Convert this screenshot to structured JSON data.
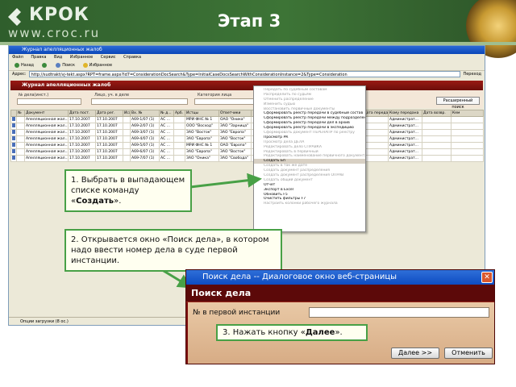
{
  "slide": {
    "logo_name": "КРОК",
    "logo_url": "www.croc.ru",
    "title": "Этап 3"
  },
  "window": {
    "title": "Журнал апелляционных жалоб"
  },
  "menu": [
    "Файл",
    "Правка",
    "Вид",
    "Избранное",
    "Сервис",
    "Справка"
  ],
  "toolbar": {
    "back": "Назад",
    "search": "Поиск",
    "favorites": "Избранное",
    "go": "Переход"
  },
  "address": {
    "label": "Адрес:",
    "value": "http://sudtrakt/vj-tekt.aspx?RPT=frame.aspx?Id7=ConsiderationDocSearch&Type=InitialCaseDocsSearchWithConsiderationInstance=2&Type=Consideration"
  },
  "journal_title": "Журнал апелляционных жалоб",
  "filters": {
    "case_no": "№ дела(инст.)",
    "person": "Лицо, уч. в деле",
    "category": "Категория лица",
    "extended_search": "Расширенный поиск"
  },
  "grid": {
    "headers": [
      "",
      "№",
      "Документ",
      "Дата пост.",
      "Дата рег.",
      "Исх.",
      "Вх. №",
      "№ д...",
      "Арб.",
      "Истцы",
      "Ответчики",
      "",
      "",
      "",
      "Дата передачи",
      "Кому передана",
      "Дата возвр.",
      "Кем"
    ],
    "rows": [
      [
        "Апелляционная жал...",
        "17.10.2007",
        "17.10.2007",
        "А69-1/07 (1)",
        "АС ...",
        "МРИ ФНС № 1",
        "ОАО \"Оника\"",
        "Администрат..."
      ],
      [
        "Апелляционная жал...",
        "17.10.2007",
        "17.10.2007",
        "А69-2/07 (1)",
        "АС ...",
        "ООО \"Восход\"",
        "ЗАО \"Зарница\"",
        "Администрат..."
      ],
      [
        "Апелляционная жал...",
        "17.10.2007",
        "17.10.2007",
        "А69-3/07 (1)",
        "АС ...",
        "ЗАО \"Восток\"",
        "ЗАО \"Европа\"",
        "Администрат..."
      ],
      [
        "Апелляционная жал...",
        "17.10.2007",
        "17.10.2007",
        "А69-4/07 (1)",
        "АС ...",
        "ЗАО \"Европа\"",
        "ЗАО \"Восток\"",
        "Администрат..."
      ],
      [
        "Апелляционная жал...",
        "17.10.2007",
        "17.10.2007",
        "А69-5/07 (1)",
        "АС ...",
        "МРИ ФНС № 1",
        "ОАО \"Европа\"",
        "Администрат..."
      ],
      [
        "Апелляционная жал...",
        "17.10.2007",
        "17.10.2007",
        "А69-6/07 (1)",
        "АС ...",
        "ЗАО \"Европа\"",
        "ЗАО \"Восток\"",
        "Администрат..."
      ],
      [
        "Апелляционная жал...",
        "17.10.2007",
        "17.10.2007",
        "А69-7/07 (1)",
        "АС ...",
        "ЗАО \"Оника\"",
        "ЗАО \"Свобода\"",
        "Администрат..."
      ]
    ]
  },
  "context_menu": [
    {
      "label": "Передать по судебным составам",
      "state": "disabled"
    },
    {
      "label": "Распределить по судьям",
      "state": "disabled"
    },
    {
      "label": "Отменить распределение",
      "state": "disabled"
    },
    {
      "label": "Изменить судью",
      "state": "disabled"
    },
    {
      "label": "Восстановить первичные документы",
      "state": "disabled"
    },
    {
      "label": "Сформировать реестр передачи в судебный состав",
      "state": "normal"
    },
    {
      "label": "Сформировать реестр передачи между подразделениями",
      "state": "normal"
    },
    {
      "label": "Сформировать реестр передачи дел в архив",
      "state": "normal"
    },
    {
      "label": "Сформировать реестр передачи в экспедицию",
      "state": "normal"
    },
    {
      "label": "Сформировать документ ПЕРЕНАПР по реестру",
      "state": "disabled"
    },
    {
      "label": "Просмотр РК",
      "state": "normal"
    },
    {
      "label": "Просмотр дела ДЕЛА",
      "state": "disabled"
    },
    {
      "label": "Редактировать дело СПРАВКА",
      "state": "disabled"
    },
    {
      "label": "Редактировать в первичный",
      "state": "disabled"
    },
    {
      "label": "Редактировать наименование первичного документа",
      "state": "disabled"
    },
    {
      "label": "Создать Бп",
      "state": "selected"
    },
    {
      "label": "Создать в так же дате",
      "state": "disabled"
    },
    {
      "label": "Создать документ распределения",
      "state": "disabled"
    },
    {
      "label": "Создать документ распределения ОПРАВ",
      "state": "disabled"
    },
    {
      "label": "Создать общий документ",
      "state": "disabled"
    },
    {
      "label": "Отчет",
      "state": "normal"
    },
    {
      "label": "Экспорт в Excel",
      "state": "normal"
    },
    {
      "label": "Обновить F5",
      "state": "normal"
    },
    {
      "label": "Очистить фильтры F7",
      "state": "normal"
    },
    {
      "label": "Настроить колонки рабочего журнала",
      "state": "disabled"
    }
  ],
  "status_bar": "Опции загрузки (8 ос.)",
  "callouts": {
    "one": {
      "text_before": "1. Выбрать в выпадающем списке команду «",
      "bold": "Создать",
      "text_after": "»."
    },
    "two": {
      "text": "2. Открывается окно «Поиск дела», в котором надо ввести номер дела в суде первой инстанции."
    },
    "three": {
      "text_before": "3. Нажать кнопку «",
      "bold": "Далее",
      "text_after": "»."
    }
  },
  "dialog": {
    "window_title": "Поиск дела -- Диалоговое окно веб-страницы",
    "header": "Поиск дела",
    "field_label": "№ в первой инстанции",
    "field_value": "",
    "next_button": "Далее >>",
    "cancel_button": "Отменить"
  },
  "colors": {
    "accent_green": "#48a046",
    "banner": "#3d7436",
    "dialog_red": "#7d0c0c"
  }
}
